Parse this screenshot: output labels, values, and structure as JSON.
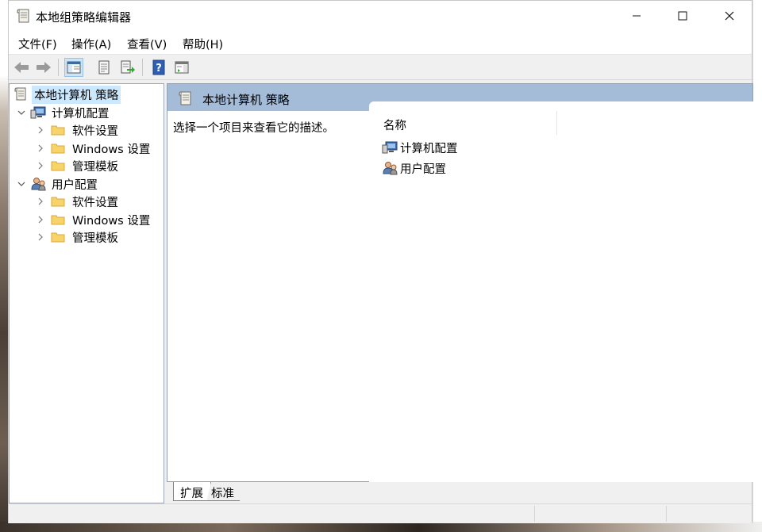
{
  "window": {
    "title": "本地组策略编辑器",
    "minimize_glyph": "—",
    "maximize_glyph": "☐",
    "close_glyph": "✕"
  },
  "menu": {
    "items": [
      {
        "label": "文件(F)"
      },
      {
        "label": "操作(A)"
      },
      {
        "label": "查看(V)"
      },
      {
        "label": "帮助(H)"
      }
    ]
  },
  "toolbar": {
    "buttons": [
      "back-icon",
      "forward-icon",
      "show-hide-tree-icon",
      "properties-icon",
      "export-list-icon",
      "help-icon",
      "show-hide-action-pane-icon"
    ]
  },
  "tree": {
    "root": {
      "label": "本地计算机 策略",
      "selected": true
    },
    "computer_config": {
      "label": "计算机配置",
      "children": [
        "软件设置",
        "Windows 设置",
        "管理模板"
      ]
    },
    "user_config": {
      "label": "用户配置",
      "children": [
        "软件设置",
        "Windows 设置",
        "管理模板"
      ]
    }
  },
  "content": {
    "header_title": "本地计算机 策略",
    "description": "选择一个项目来查看它的描述。",
    "column_name": "名称",
    "items": [
      "计算机配置",
      "用户配置"
    ]
  },
  "tabs": {
    "extended": "扩展",
    "standard": "标准"
  },
  "colors": {
    "header_blue": "#a4bcd8",
    "selection": "#cce8ff",
    "folder": "#f7d46a"
  }
}
